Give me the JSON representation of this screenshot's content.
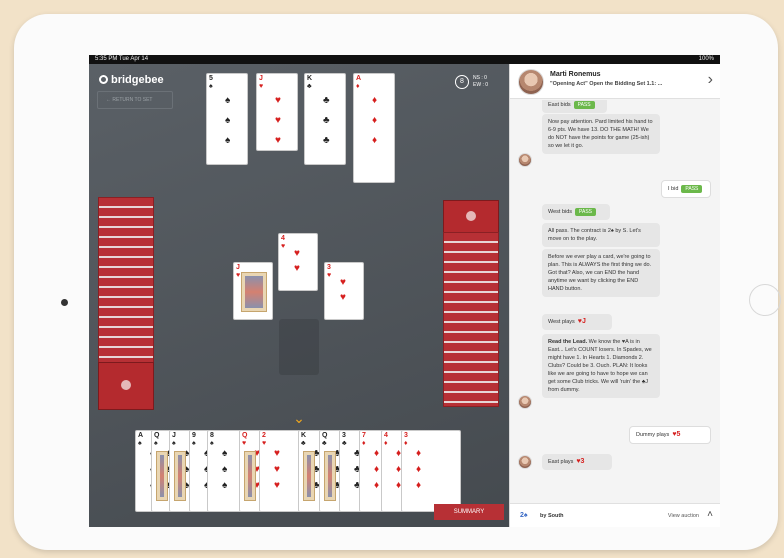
{
  "status": {
    "time": "5:35 PM  Tue Apr 14",
    "battery": "100%"
  },
  "game": {
    "logo": "bridgebee",
    "back_label": "←  RETURN TO SET",
    "vuln_symbol": "8",
    "vuln_ns": "NS : 0",
    "vuln_ew": "EW : 0",
    "summary_label": "SUMMARY",
    "dummy_cards": [
      {
        "rank": "5",
        "suit": "♠",
        "color": "black"
      },
      {
        "rank": "J",
        "suit": "♥",
        "color": "red"
      },
      {
        "rank": "K",
        "suit": "♣",
        "color": "black"
      },
      {
        "rank": "A",
        "suit": "♦",
        "color": "red"
      }
    ],
    "trick_cards": [
      {
        "rank": "J",
        "suit": "♥",
        "color": "red"
      },
      {
        "rank": "4",
        "suit": "♥",
        "color": "red"
      },
      {
        "rank": "3",
        "suit": "♥",
        "color": "red"
      }
    ],
    "south_hand": [
      {
        "rank": "A",
        "suit": "♠",
        "color": "black"
      },
      {
        "rank": "Q",
        "suit": "♠",
        "color": "black"
      },
      {
        "rank": "J",
        "suit": "♠",
        "color": "black"
      },
      {
        "rank": "9",
        "suit": "♠",
        "color": "black"
      },
      {
        "rank": "8",
        "suit": "♠",
        "color": "black"
      },
      {
        "rank": "Q",
        "suit": "♥",
        "color": "red"
      },
      {
        "rank": "2",
        "suit": "♥",
        "color": "red"
      },
      {
        "rank": "K",
        "suit": "♣",
        "color": "black"
      },
      {
        "rank": "Q",
        "suit": "♣",
        "color": "black"
      },
      {
        "rank": "3",
        "suit": "♣",
        "color": "black"
      },
      {
        "rank": "7",
        "suit": "♦",
        "color": "red"
      },
      {
        "rank": "4",
        "suit": "♦",
        "color": "red"
      },
      {
        "rank": "3",
        "suit": "♦",
        "color": "red"
      }
    ]
  },
  "chat": {
    "header_name": "Marti Ronemus",
    "header_subtitle": "\"Opening Act\" Open the Bidding Set 1.1: ...",
    "messages": {
      "east_bids_label": "East bids",
      "east_bid": "PASS",
      "pay_attention": "Now pay attention. Pard limited his hand to 6-9 pts. We have 13. DO THE MATH! We do NOT have the points for game (25-ish) so we let it go.",
      "i_bid_label": "I bid",
      "i_bid": "PASS",
      "west_bids_label": "West bids",
      "west_bid": "PASS",
      "all_pass": "All pass. The contract is 2♠ by S. Let's move on to the play.",
      "before_play": "Before we ever play a card, we're going to plan. This is ALWAYS the first thing we do. Got that? Also, we can END the hand anytime we want by clicking the END HAND button.",
      "west_plays_label": "West plays",
      "west_plays_card": "♥J",
      "lead_bold": "Read the Lead.",
      "lead_text": " We know the ♥A is in East... Let's COUNT losers. In Spades, we might have 1. In Hearts 1. Diamonds 2. Clubs? Could be 3. Ouch. PLAN: It looks like we are going to have to hope we can get some Club tricks. We will 'ruin' the ♣J from dummy.",
      "dummy_plays_label": "Dummy plays",
      "dummy_plays_card": "♥5",
      "east_plays_label": "East plays",
      "east_plays_card": "♥3"
    },
    "footer": {
      "contract": "2♠",
      "by": "by South",
      "view_auction": "View auction"
    }
  }
}
